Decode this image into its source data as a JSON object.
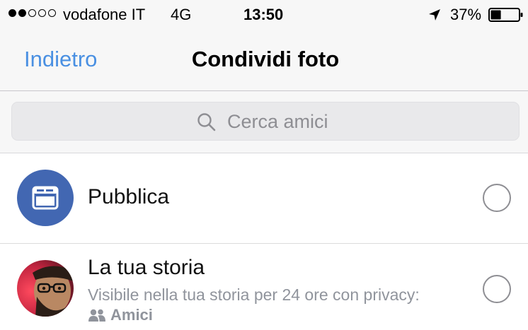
{
  "status_bar": {
    "carrier": "vodafone IT",
    "network": "4G",
    "time": "13:50",
    "battery_percent": "37%",
    "battery_level": 0.37,
    "signal_strength_dots": 2,
    "signal_total_dots": 5
  },
  "nav": {
    "back_label": "Indietro",
    "title": "Condividi foto"
  },
  "search": {
    "placeholder": "Cerca amici",
    "icon": "search-icon"
  },
  "options": [
    {
      "title": "Pubblica",
      "icon": "news-feed-icon",
      "selected": false
    },
    {
      "title": "La tua storia",
      "subtitle": "Visibile nella tua storia per 24 ore con privacy:",
      "privacy_label": "Amici",
      "privacy_icon": "friends-icon",
      "selected": false
    }
  ],
  "colors": {
    "accent": "#4a90e2",
    "facebook_blue": "#4267b2",
    "secondary_text": "#90949c",
    "bar_background": "#f7f7f7"
  }
}
